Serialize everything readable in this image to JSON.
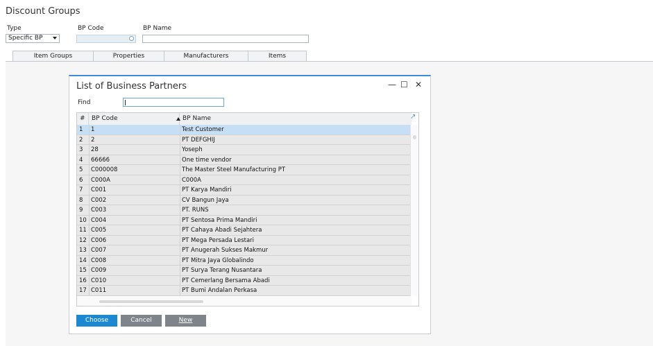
{
  "window": {
    "title": "Discount Groups"
  },
  "header": {
    "type_label": "Type",
    "type_value": "Specific BP",
    "bp_code_label": "BP Code",
    "bp_code_value": "",
    "bp_name_label": "BP Name",
    "bp_name_value": ""
  },
  "tabs": [
    {
      "label": "Item Groups"
    },
    {
      "label": "Properties"
    },
    {
      "label": "Manufacturers"
    },
    {
      "label": "Items"
    }
  ],
  "dialog": {
    "title": "List of Business Partners",
    "controls": {
      "minimize": "—",
      "maximize": "☐",
      "close": "✕"
    },
    "find_label": "Find",
    "find_value": "",
    "columns": {
      "num": "#",
      "code": "BP Code",
      "name": "BP Name"
    },
    "rows": [
      {
        "num": "1",
        "code": "1",
        "name": "Test Customer"
      },
      {
        "num": "2",
        "code": "2",
        "name": "PT DEFGHIJ"
      },
      {
        "num": "3",
        "code": "28",
        "name": "Yoseph"
      },
      {
        "num": "4",
        "code": "66666",
        "name": "One time vendor"
      },
      {
        "num": "5",
        "code": "C000008",
        "name": "The Master Steel Manufacturing PT"
      },
      {
        "num": "6",
        "code": "C000A",
        "name": "C000A"
      },
      {
        "num": "7",
        "code": "C001",
        "name": "PT Karya Mandiri"
      },
      {
        "num": "8",
        "code": "C002",
        "name": "CV Bangun Jaya"
      },
      {
        "num": "9",
        "code": "C003",
        "name": "PT. RUNS"
      },
      {
        "num": "10",
        "code": "C004",
        "name": "PT Sentosa Prima Mandiri"
      },
      {
        "num": "11",
        "code": "C005",
        "name": "PT Cahaya Abadi Sejahtera"
      },
      {
        "num": "12",
        "code": "C006",
        "name": "PT Mega Persada Lestari"
      },
      {
        "num": "13",
        "code": "C007",
        "name": "PT Anugerah Sukses Makmur"
      },
      {
        "num": "14",
        "code": "C008",
        "name": "PT Mitra Jaya Globalindo"
      },
      {
        "num": "15",
        "code": "C009",
        "name": "PT Surya Terang Nusantara"
      },
      {
        "num": "16",
        "code": "C010",
        "name": "PT Cemerlang Bersama Abadi"
      },
      {
        "num": "17",
        "code": "C011",
        "name": "PT Bumi Andalan Perkasa"
      }
    ],
    "buttons": {
      "choose": "Choose",
      "cancel": "Cancel",
      "new": "New"
    }
  },
  "colors": {
    "accent": "#1d88d2",
    "selected_row": "#c7dff5",
    "button_gray": "#7e848a"
  }
}
